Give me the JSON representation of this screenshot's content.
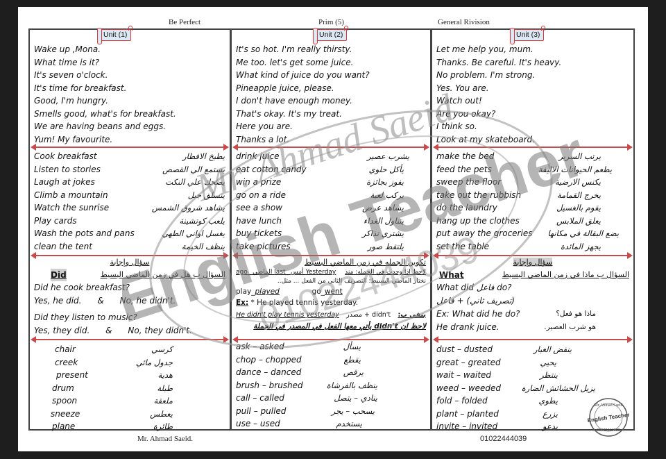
{
  "header": {
    "left": "Be Perfect",
    "center": "Prim (5)",
    "right": "General Rivision"
  },
  "footer": {
    "author": "Mr. Ahmad Saeid.",
    "phone": "01022444039"
  },
  "watermark": {
    "line1": "Mr. Ahmad Saeid",
    "line2": "English Teacher",
    "line3": "01022444039"
  },
  "stamp": {
    "top": "Mr.Ahmad Saeid",
    "middle": "English Teacher",
    "bottom": "01022444039"
  },
  "units": [
    {
      "title": "Unit (1)",
      "dialogue": [
        "Wake up ,Mona.",
        "What time is it?",
        "It's seven o'clock.",
        "It's time for breakfast.",
        "Good, I'm hungry.",
        "Smells good, what's for breakfast.",
        "We are having beans and eggs.",
        "Yum! My favourite."
      ],
      "vocab": [
        {
          "en": "Cook breakfast",
          "ar": "يطبخ الافطار"
        },
        {
          "en": "Listen to stories",
          "ar": "يستمع الي القصص"
        },
        {
          "en": "Laugh at jokes",
          "ar": "يضحك علي النكت"
        },
        {
          "en": "Climb a mountain",
          "ar": "يتسلق جبل"
        },
        {
          "en": "Watch the sunrise",
          "ar": "يشاهد شروق الشمس"
        },
        {
          "en": "Play cards",
          "ar": "يلعب كوتشينة"
        },
        {
          "en": "Wash the pots and pans",
          "ar": "يغسل اواني الطهي"
        },
        {
          "en": "clean the tent",
          "ar": "ينظف الخيمة"
        }
      ],
      "grammar": {
        "title": "سؤال وإجابة",
        "keyword": "Did",
        "rule": "السؤال ب هل في زمن الماضي البسيط",
        "lines": [
          "Did he cook breakfast?",
          "Yes, he did.      &      No, he didn't.",
          "Did they  listen to music?",
          "Yes, they did.      &      No, they didn't."
        ]
      },
      "words": [
        {
          "en": "chair",
          "ar": "كرسي"
        },
        {
          "en": "creek",
          "ar": "جدول مائي"
        },
        {
          "en": "present",
          "ar": "هدية"
        },
        {
          "en": "drum",
          "ar": "طبلة"
        },
        {
          "en": "spoon",
          "ar": "ملعقة"
        },
        {
          "en": "sneeze",
          "ar": "يعطس"
        },
        {
          "en": "plane",
          "ar": "طائرة"
        }
      ]
    },
    {
      "title": "Unit (2)",
      "dialogue": [
        "It's so hot. I'm really thirsty.",
        "Me too. let's get some juice.",
        "What kind of  juice do you want?",
        "Pineapple  juice, please.",
        "I don't have enough money.",
        "That's okay. It's my treat.",
        "Here you are.",
        "Thanks a lot."
      ],
      "vocab": [
        {
          "en": "drink  juice",
          "ar": "يشرب عصير"
        },
        {
          "en": "eat cotton candy",
          "ar": "يأكل حلوي"
        },
        {
          "en": "win a prize",
          "ar": "يفوز بجائزة"
        },
        {
          "en": "go on a ride",
          "ar": "يركب لعبة"
        },
        {
          "en": "see a show",
          "ar": "يشاهد عرض"
        },
        {
          "en": "have lunch",
          "ar": "يتناول الغداء"
        },
        {
          "en": "buy tickets",
          "ar": "يشتري تذاكر"
        },
        {
          "en": "take pictures",
          "ar": "يلتقط صور"
        }
      ],
      "grammar": {
        "title": "تكوين الجمله في زمن الماضي البسيط",
        "note1_ar": "لاحظ اذا وجدت في الجمله:  منذ",
        "note1_words": "Yesterday أمس _last الماضي _ago",
        "note2": "نختار الماضي البسيط: التصريف الثاني من الفعل ... مثل..",
        "pair1_base": "play_",
        "pair1_past": "played",
        "pair2_base": "go_",
        "pair2_past": "went",
        "ex_label": "Ex:",
        "ex_text": "* He played tennis yesterday.",
        "neg_label": "بنفي ب:",
        "neg_formula": "didn't + مصدر",
        "neg_example": "He didn't play tennis yesterday",
        "note3": "لاحظ ان  didn't  يأتي معها الفعل في المصدر في الجملة"
      },
      "words": [
        {
          "en": "ask – asked",
          "ar": "يسأل"
        },
        {
          "en": "chop – chopped",
          "ar": "يقطع"
        },
        {
          "en": "dance – danced",
          "ar": "يرقص"
        },
        {
          "en": "brush – brushed",
          "ar": "ينظف بالفرشاة"
        },
        {
          "en": "call – called",
          "ar": "ينادي – يتصل"
        },
        {
          "en": "pull – pulled",
          "ar": "يسحب – يجر"
        },
        {
          "en": "use – used",
          "ar": "يستخدم"
        }
      ]
    },
    {
      "title": "Unit (3)",
      "dialogue": [
        "Let me help you, mum.",
        "Thanks. Be careful. It's heavy.",
        "No problem. I'm strong.",
        "Yes. You are.",
        "Watch out!",
        "Are you okay?",
        "I think so.",
        "Look at my skateboard."
      ],
      "vocab": [
        {
          "en": "make the bed",
          "ar": "يرتب السرير"
        },
        {
          "en": "feed the pets",
          "ar": "يطعم الحيوانات الاليفة"
        },
        {
          "en": "sweep the floor",
          "ar": "يكنس الارضية"
        },
        {
          "en": "take out the rubbish",
          "ar": "يخرج القمامة"
        },
        {
          "en": "do the laundry",
          "ar": "يقوم بالغسيل"
        },
        {
          "en": "hang up the clothes",
          "ar": "يعلق الملابس"
        },
        {
          "en": "put away the groceries",
          "ar": "يضع البقالة في مكانها"
        },
        {
          "en": "set the table",
          "ar": "يجهز المائدة"
        }
      ],
      "grammar": {
        "title": "سؤال وإجابة",
        "keyword": "What",
        "rule": "السؤال ب ماذا في زمن الماضي البسيط",
        "line1": "What did فاعل do?",
        "line2": "(تصريف ثاني) + فاعل",
        "ex_en": "Ex: What did he do?",
        "ex_ar": "ماذا هو فعل؟",
        "ans_en": "He drank  juice.",
        "ans_ar": "هو شرب العصير."
      },
      "words": [
        {
          "en": "dust – dusted",
          "ar": "ينفض الغبار"
        },
        {
          "en": "great – greated",
          "ar": "يحيي"
        },
        {
          "en": "wait – waited",
          "ar": "ينتظر"
        },
        {
          "en": "weed – weeded",
          "ar": "يزيل الحشائش الضارة"
        },
        {
          "en": "fold – folded",
          "ar": "يطوي"
        },
        {
          "en": "plant – planted",
          "ar": "يزرع"
        },
        {
          "en": "invite – invited",
          "ar": "يدعو"
        }
      ]
    }
  ]
}
